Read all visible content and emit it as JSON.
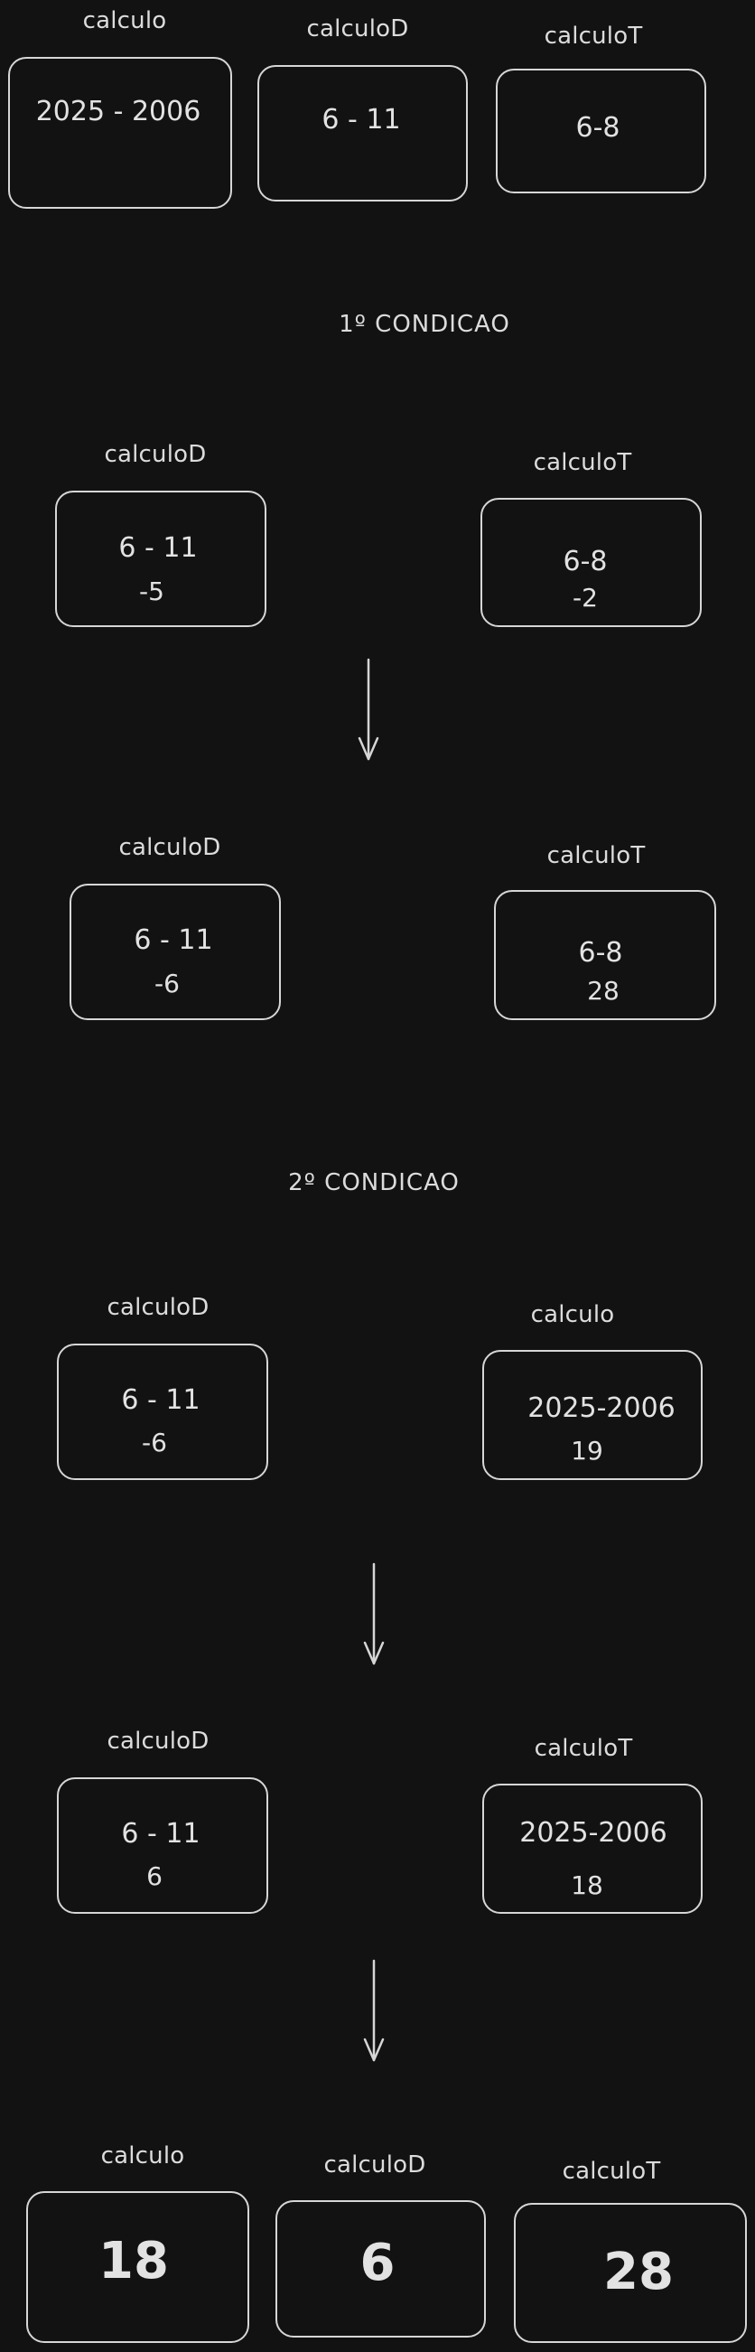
{
  "top": {
    "calculo": {
      "label": "calculo",
      "expr": "2025 - 2006"
    },
    "calculoD": {
      "label": "calculoD",
      "expr": "6 - 11"
    },
    "calculoT": {
      "label": "calculoT",
      "expr": "6-8"
    }
  },
  "condition1": {
    "title": "1º CONDICAO",
    "step1": {
      "left": {
        "label": "calculoD",
        "expr": "6 - 11",
        "result": "-5"
      },
      "right": {
        "label": "calculoT",
        "expr": "6-8",
        "result": "-2"
      }
    },
    "step2": {
      "left": {
        "label": "calculoD",
        "expr": "6 - 11",
        "result": "-6"
      },
      "right": {
        "label": "calculoT",
        "expr": "6-8",
        "result": "28"
      }
    }
  },
  "condition2": {
    "title": "2º CONDICAO",
    "step1": {
      "left": {
        "label": "calculoD",
        "expr": "6 - 11",
        "result": "-6"
      },
      "right": {
        "label": "calculo",
        "expr": "2025-2006",
        "result": "19"
      }
    },
    "step2": {
      "left": {
        "label": "calculoD",
        "expr": "6 - 11",
        "result": "6"
      },
      "right": {
        "label": "calculoT",
        "expr": "2025-2006",
        "result": "18"
      }
    }
  },
  "final": {
    "calculo": {
      "label": "calculo",
      "value": "18"
    },
    "calculoD": {
      "label": "calculoD",
      "value": "6"
    },
    "calculoT": {
      "label": "calculoT",
      "value": "28"
    }
  }
}
